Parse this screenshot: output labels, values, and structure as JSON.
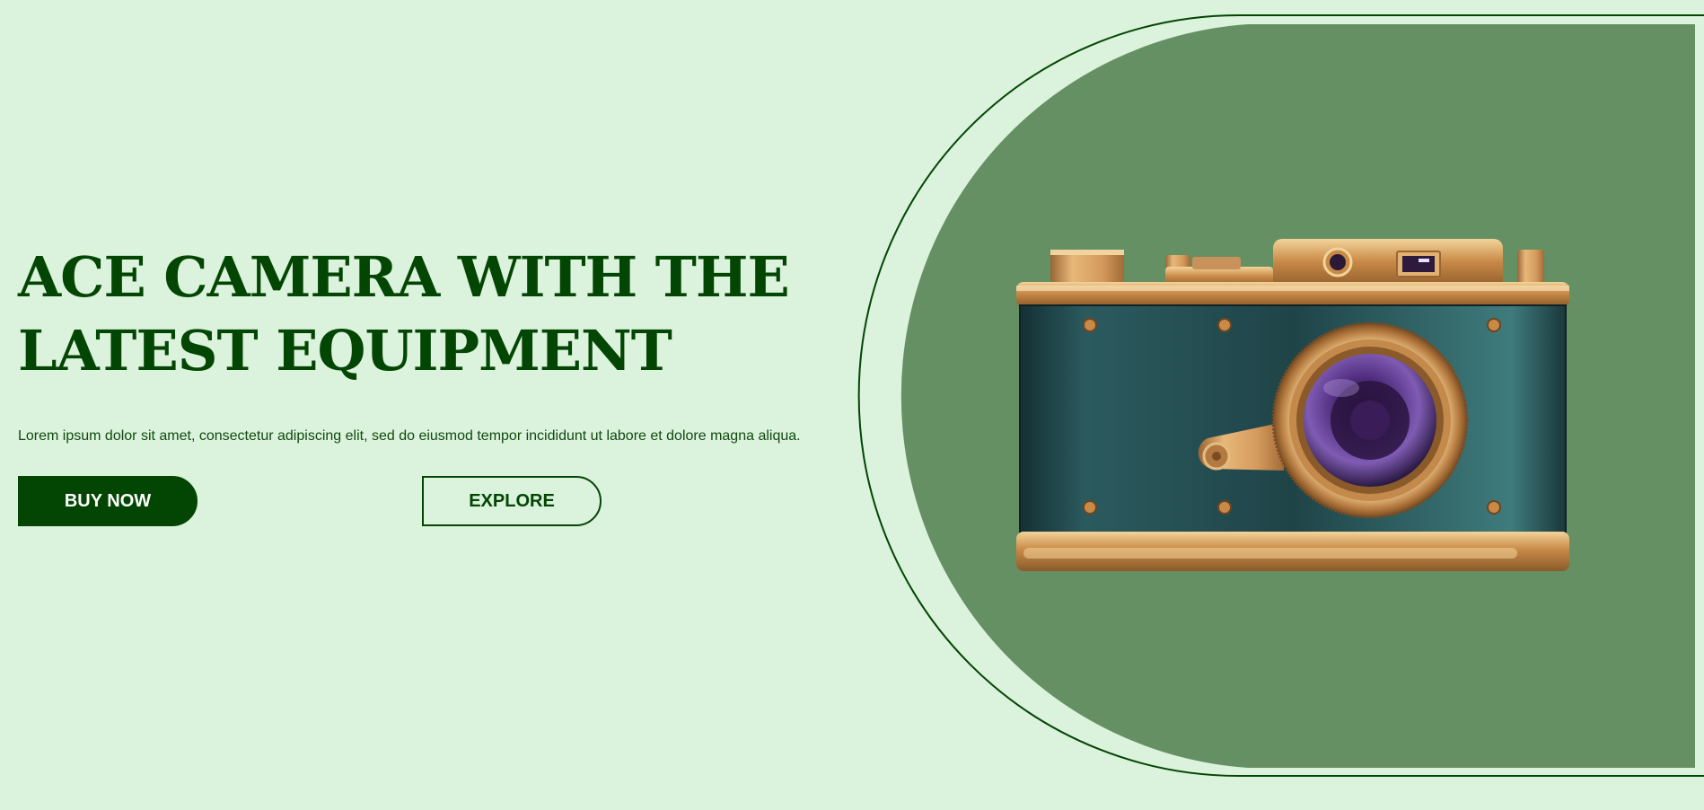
{
  "hero": {
    "headline_line1": "ACE CAMERA WITH THE",
    "headline_line2": "LATEST EQUIPMENT",
    "description": "Lorem ipsum dolor sit amet, consectetur adipiscing elit, sed do eiusmod tempor incididunt ut labore et dolore magna aliqua.",
    "buy_label": "BUY NOW",
    "explore_label": "EXPLORE"
  },
  "image": {
    "icon": "camera-icon"
  },
  "colors": {
    "background": "#dbf2dc",
    "primary": "#034603",
    "panel": "#649063"
  }
}
